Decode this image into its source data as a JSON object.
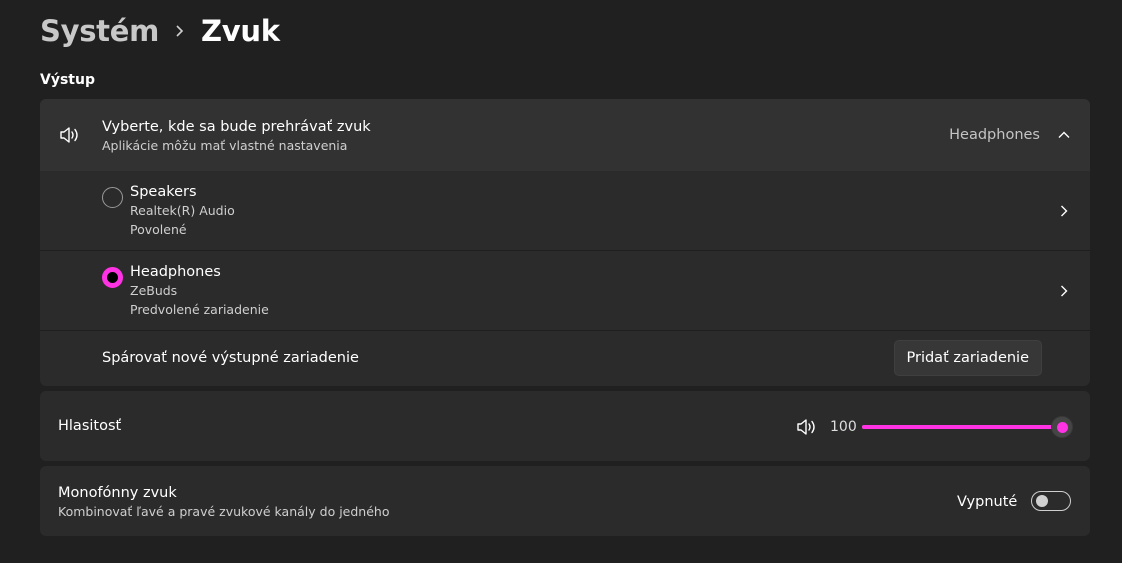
{
  "breadcrumb": {
    "parent": "Systém",
    "current": "Zvuk"
  },
  "output": {
    "section_title": "Výstup",
    "header": {
      "title": "Vyberte, kde sa bude prehrávať zvuk",
      "subtitle": "Aplikácie môžu mať vlastné nastavenia",
      "value": "Headphones",
      "expanded": true
    },
    "devices": [
      {
        "name": "Speakers",
        "driver": "Realtek(R) Audio",
        "status": "Povolené",
        "selected": false
      },
      {
        "name": "Headphones",
        "driver": "ZeBuds",
        "status": "Predvolené zariadenie",
        "selected": true
      }
    ],
    "pair": {
      "label": "Spárovať nové výstupné zariadenie",
      "button_label": "Pridať zariadenie"
    }
  },
  "volume": {
    "label": "Hlasitosť",
    "value": "100",
    "level_percent": 100
  },
  "mono": {
    "title": "Monofónny zvuk",
    "subtitle": "Kombinovať ľavé a pravé zvukové kanály do jedného",
    "state_label": "Vypnuté",
    "on": false
  },
  "colors": {
    "accent": "#ff33e4",
    "background": "#202020",
    "card": "#2b2b2b",
    "card_header": "#323232"
  },
  "icons": {
    "speaker": "speaker-icon",
    "chevron_up": "chevron-up-icon",
    "chevron_right": "chevron-right-icon",
    "breadcrumb_sep": "chevron-right-icon"
  }
}
